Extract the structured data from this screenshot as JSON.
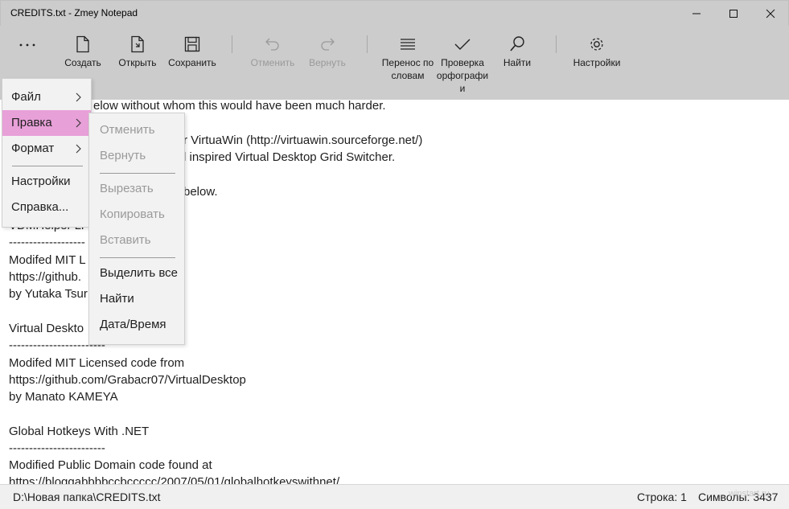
{
  "window": {
    "title": "CREDITS.txt - Zmey Notepad"
  },
  "toolbar": {
    "more_label": "...",
    "buttons": [
      {
        "label": "Создать",
        "icon": "new-file-icon",
        "enabled": true
      },
      {
        "label": "Открыть",
        "icon": "open-file-icon",
        "enabled": true
      },
      {
        "label": "Сохранить",
        "icon": "save-icon",
        "enabled": true
      },
      {
        "label": "Отменить",
        "icon": "undo-icon",
        "enabled": false
      },
      {
        "label": "Вернуть",
        "icon": "redo-icon",
        "enabled": false
      },
      {
        "label": "Перенос по\nсловам",
        "icon": "word-wrap-icon",
        "enabled": true
      },
      {
        "label": "Проверка\nорфографи\nи",
        "icon": "spellcheck-icon",
        "enabled": true
      },
      {
        "label": "Найти",
        "icon": "search-icon",
        "enabled": true
      },
      {
        "label": "Настройки",
        "icon": "gear-icon",
        "enabled": true
      }
    ]
  },
  "editor": {
    "lines": [
      "elow without whom this would have been much harder.",
      "",
      "r VirtuaWin (http://virtuawin.sourceforge.net/)",
      "l inspired Virtual Desktop Grid Switcher.",
      "",
      "below.",
      "",
      "VDMHelper Li",
      "-------------------",
      "Modifed MIT L                    m",
      "https://github.                  Helper",
      "by Yutaka Tsur",
      "",
      "Virtual Deskto",
      "------------------------",
      "Modifed MIT Licensed code from",
      "https://github.com/Grabacr07/VirtualDesktop",
      "by Manato KAMEYA",
      "",
      "Global Hotkeys With .NET",
      "------------------------",
      "Modified Public Domain code found at",
      "https://bloggabbbbccbccccc/2007/05/01/globalhotkeyswithnet/"
    ]
  },
  "menu": {
    "items": [
      {
        "label": "Файл",
        "has_submenu": true
      },
      {
        "label": "Правка",
        "has_submenu": true,
        "active": true
      },
      {
        "label": "Формат",
        "has_submenu": true
      },
      {
        "label": "Настройки",
        "has_submenu": false
      },
      {
        "label": "Справка...",
        "has_submenu": false
      }
    ],
    "active_color": "#e8a0d8"
  },
  "submenu": {
    "items": [
      {
        "label": "Отменить",
        "enabled": false
      },
      {
        "label": "Вернуть",
        "enabled": false
      },
      {
        "label": "Вырезать",
        "enabled": false
      },
      {
        "label": "Копировать",
        "enabled": false
      },
      {
        "label": "Вставить",
        "enabled": false
      },
      {
        "label": "Выделить все",
        "enabled": true
      },
      {
        "label": "Найти",
        "enabled": true
      },
      {
        "label": "Дата/Время",
        "enabled": true
      }
    ]
  },
  "status": {
    "path": "D:\\Новая папка\\CREDITS.txt",
    "line": "Строка: 1",
    "chars": "Символы: 3437"
  },
  "watermark": "winstart.ru"
}
